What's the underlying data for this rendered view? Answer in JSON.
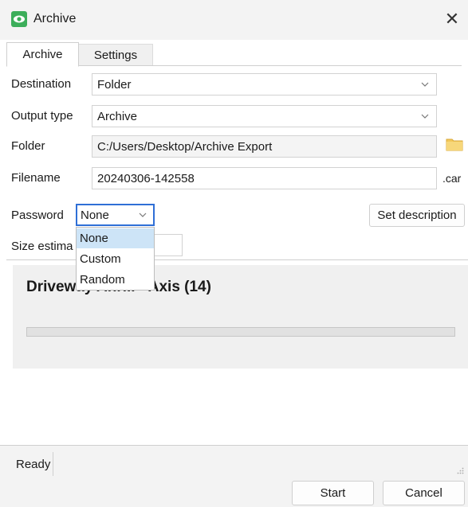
{
  "window": {
    "title": "Archive",
    "app_icon": "eye-icon",
    "accent": "#3cae5a"
  },
  "tabs": [
    {
      "label": "Archive",
      "active": true
    },
    {
      "label": "Settings",
      "active": false
    }
  ],
  "form": {
    "destination": {
      "label": "Destination",
      "value": "Folder"
    },
    "output_type": {
      "label": "Output type",
      "value": "Archive"
    },
    "folder": {
      "label": "Folder",
      "value": "C:/Users/Desktop/Archive Export"
    },
    "filename": {
      "label": "Filename",
      "value": "20240306-142558",
      "suffix": ".car"
    },
    "password": {
      "label": "Password",
      "value": "None",
      "options": [
        "None",
        "Custom",
        "Random"
      ]
    },
    "size_estimate": {
      "label": "Size estima"
    },
    "set_description_label": "Set description"
  },
  "panel": {
    "title": "Driveway Anri.. - Axis (14)"
  },
  "status": {
    "text": "Ready"
  },
  "buttons": {
    "start": "Start",
    "cancel": "Cancel"
  }
}
